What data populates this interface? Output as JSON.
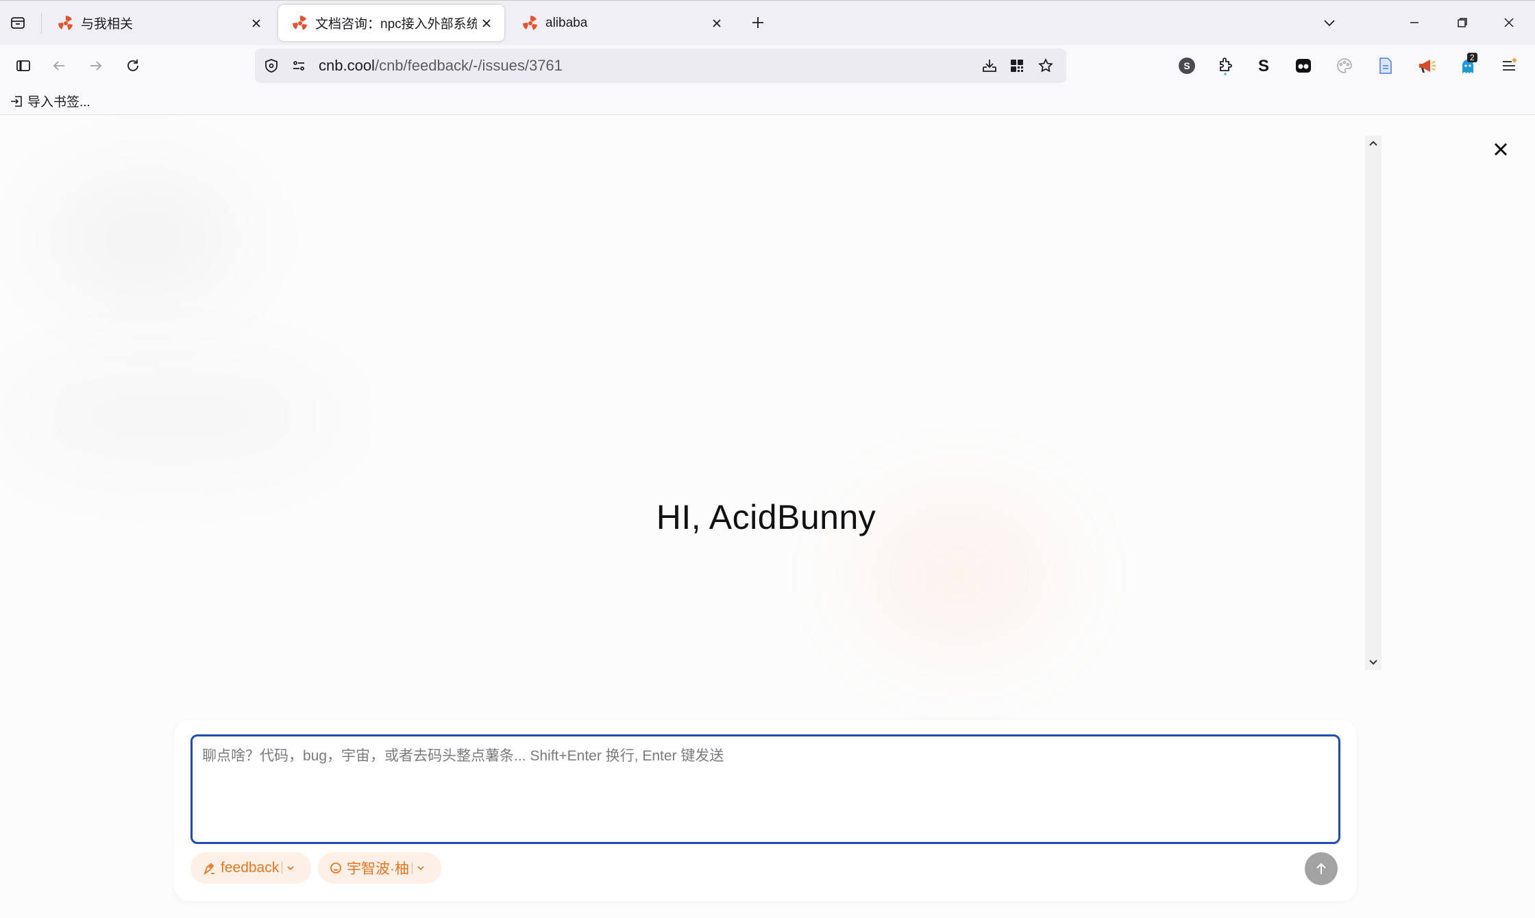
{
  "browser": {
    "tabs": [
      {
        "title": "与我相关",
        "active": false
      },
      {
        "title": "文档咨询：npc接入外部系统 · I",
        "active": true
      },
      {
        "title": "alibaba",
        "active": false
      }
    ],
    "url": {
      "domain": "cnb.cool",
      "path": "/cnb/feedback/-/issues/3761"
    },
    "bookmarks": {
      "import_label": "导入书签..."
    },
    "extension_badge": "2",
    "accent_color": "#e8751f"
  },
  "page": {
    "greeting": "HI, AcidBunny",
    "chat": {
      "placeholder": "聊点啥？代码，bug，宇宙，或者去码头整点薯条... Shift+Enter 换行, Enter 键发送",
      "value": "",
      "repo_chip": "feedback",
      "model_chip": "宇智波·柚"
    }
  }
}
